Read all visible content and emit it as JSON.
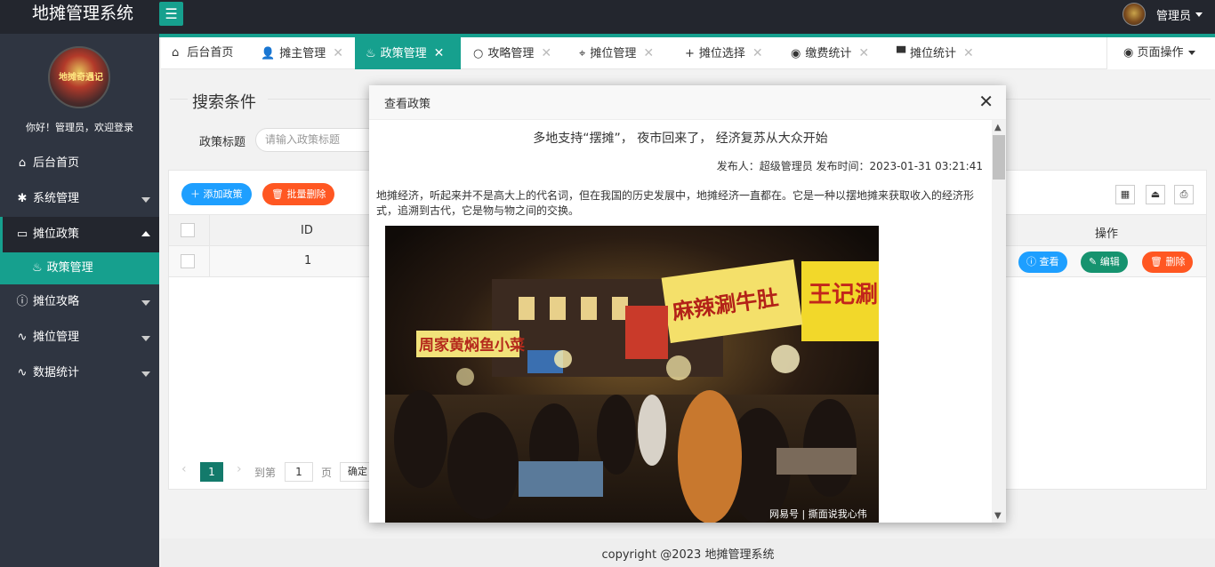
{
  "app": {
    "title": "地摊管理系统",
    "menu_toggle_icon": "☰"
  },
  "user": {
    "name": "管理员",
    "welcome": "你好！管理员，欢迎登录",
    "avatar_text": "地摊奇遇记"
  },
  "sidebar": {
    "items": [
      {
        "label": "后台首页",
        "icon": "home-icon"
      },
      {
        "label": "系统管理",
        "icon": "gear-icon"
      },
      {
        "label": "摊位政策",
        "icon": "window-icon"
      },
      {
        "label": "政策管理",
        "icon": "fire-icon"
      },
      {
        "label": "摊位攻略",
        "icon": "info-icon"
      },
      {
        "label": "摊位管理",
        "icon": "pulse-icon"
      },
      {
        "label": "数据统计",
        "icon": "pulse-icon"
      }
    ]
  },
  "tabs": [
    {
      "label": "后台首页"
    },
    {
      "label": "摊主管理"
    },
    {
      "label": "政策管理"
    },
    {
      "label": "攻略管理"
    },
    {
      "label": "摊位管理"
    },
    {
      "label": "摊位选择"
    },
    {
      "label": "缴费统计"
    },
    {
      "label": "摊位统计"
    }
  ],
  "page_ops": "页面操作",
  "search": {
    "legend": "搜索条件",
    "label": "政策标题",
    "placeholder": "请输入政策标题"
  },
  "toolbar": {
    "add": "添加政策",
    "batch_delete": "批量删除"
  },
  "table": {
    "headers": {
      "id": "ID",
      "ops": "操作"
    },
    "rows": [
      {
        "id": "1"
      }
    ],
    "row_buttons": {
      "view": "查看",
      "edit": "编辑",
      "delete": "删除"
    }
  },
  "pager": {
    "current": "1",
    "goto_label": "到第",
    "goto_value": "1",
    "page_label": "页",
    "confirm": "确定"
  },
  "footer": "copyright @2023 地摊管理系统",
  "modal": {
    "title": "查看政策",
    "article_title": "多地支持“摆摊”， 夜市回来了， 经济复苏从大众开始",
    "meta": "发布人：超级管理员 发布时间：2023-01-31 03:21:41",
    "body": "地摊经济，听起来并不是高大上的代名词，但在我国的历史发展中，地摊经济一直都在。它是一种以摆地摊来获取收入的经济形式，追溯到古代，它是物与物之间的交换。",
    "image_signs": {
      "sign1": "王记涮",
      "sign2": "麻辣涮牛肚",
      "sign3": "周家黄焖鱼小菜",
      "watermark": "网易号 | 撕面说我心伟"
    }
  },
  "colors": {
    "accent": "#16a08e",
    "sidebar_bg": "#2f3541",
    "topbar_bg": "#23262e",
    "blue": "#1e9fff",
    "red": "#ff5722",
    "green": "#16936f"
  }
}
